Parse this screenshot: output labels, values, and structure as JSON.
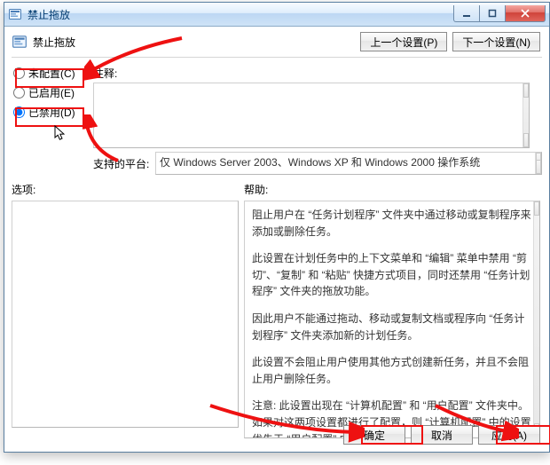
{
  "window": {
    "title": "禁止拖放",
    "header_title": "禁止拖放",
    "btn_prev": "上一个设置(P)",
    "btn_next": "下一个设置(N)"
  },
  "radios": {
    "not_configured": "未配置(C)",
    "enabled": "已启用(E)",
    "disabled": "已禁用(D)",
    "selected": "disabled"
  },
  "labels": {
    "comment": "注释:",
    "platform": "支持的平台:",
    "options": "选项:",
    "help": "帮助:"
  },
  "fields": {
    "comment_text": "",
    "platform_text": "仅 Windows Server 2003、Windows XP 和 Windows 2000 操作系统"
  },
  "help_paragraphs": [
    "阻止用户在 “任务计划程序” 文件夹中通过移动或复制程序来添加或删除任务。",
    "此设置在计划任务中的上下文菜单和 “编辑” 菜单中禁用 “剪切”、“复制” 和 “粘贴” 快捷方式项目，同时还禁用 “任务计划程序” 文件夹的拖放功能。",
    "因此用户不能通过拖动、移动或复制文档或程序向 “任务计划程序” 文件夹添加新的计划任务。",
    "此设置不会阻止用户使用其他方式创建新任务，并且不会阻止用户删除任务。",
    "注意: 此设置出现在 “计算机配置” 和 “用户配置” 文件夹中。如果对这两项设置都进行了配置，则 “计算机配置” 中的设置优先于 “用户配置” 中的设置。"
  ],
  "buttons": {
    "ok": "确定",
    "cancel": "取消",
    "apply": "应用(A)"
  },
  "icons": {
    "app": "policy-icon",
    "minimize": "minimize-icon",
    "maximize": "maximize-icon",
    "close": "close-icon"
  }
}
